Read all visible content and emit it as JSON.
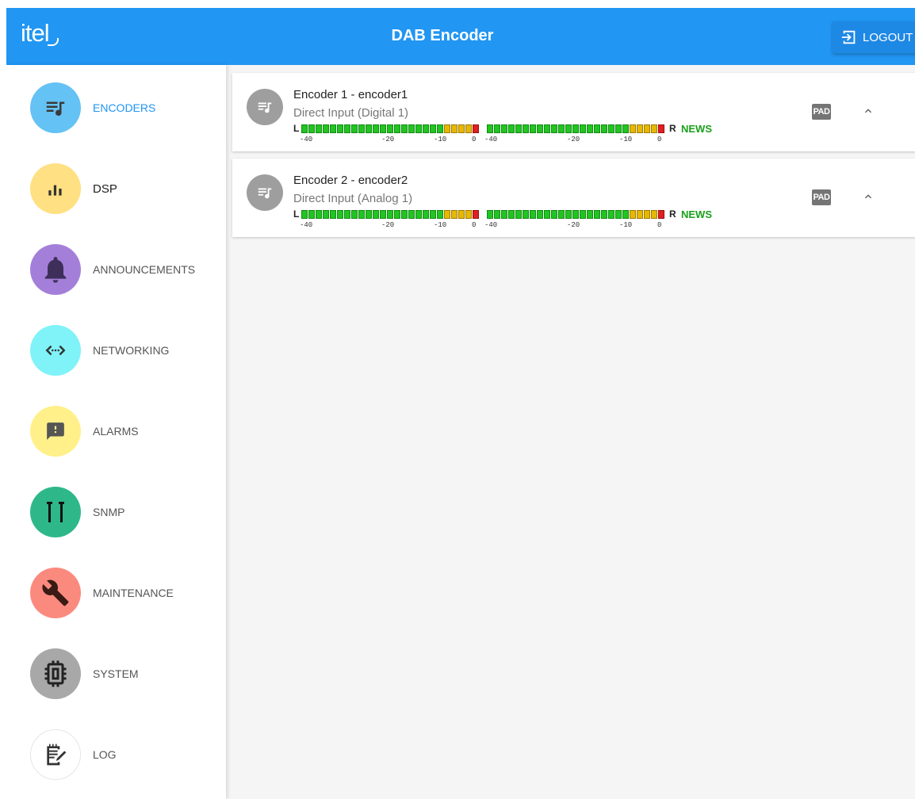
{
  "header": {
    "logo_text": "itel",
    "title": "DAB Encoder",
    "logout_label": "LOGOUT"
  },
  "sidebar": {
    "items": [
      {
        "label": "ENCODERS",
        "icon": "queue-music-icon",
        "color": "#64c2f5",
        "active": true
      },
      {
        "label": "DSP",
        "icon": "equalizer-icon",
        "color": "#ffe082"
      },
      {
        "label": "ANNOUNCEMENTS",
        "icon": "bell-icon",
        "color": "#a47fd9"
      },
      {
        "label": "NETWORKING",
        "icon": "code-arrows-icon",
        "color": "#7ff3f8"
      },
      {
        "label": "ALARMS",
        "icon": "alert-message-icon",
        "color": "#fff08a"
      },
      {
        "label": "SNMP",
        "icon": "snmp-icon",
        "color": "#2eb88a"
      },
      {
        "label": "MAINTENANCE",
        "icon": "wrench-icon",
        "color": "#fb8a7e"
      },
      {
        "label": "SYSTEM",
        "icon": "chip-icon",
        "color": "#a8a8a8"
      },
      {
        "label": "LOG",
        "icon": "notepad-icon",
        "color": "#ffffff"
      }
    ]
  },
  "encoders": [
    {
      "title": "Encoder 1 - encoder1",
      "subtitle": "Direct Input (Digital 1)",
      "left_label": "L",
      "right_label": "R",
      "status": "NEWS",
      "ticks": [
        "-40",
        "-20",
        "-10",
        "0"
      ],
      "pad_label": "PAD"
    },
    {
      "title": "Encoder 2 - encoder2",
      "subtitle": "Direct Input (Analog 1)",
      "left_label": "L",
      "right_label": "R",
      "status": "NEWS",
      "ticks": [
        "-40",
        "-20",
        "-10",
        "0"
      ],
      "pad_label": "PAD"
    }
  ],
  "colors": {
    "primary": "#2196f3",
    "active_text": "#2196f3",
    "meter_green": "#22c422",
    "meter_yellow": "#e6b800",
    "meter_red": "#e02020",
    "news_green": "#1aa01a"
  }
}
